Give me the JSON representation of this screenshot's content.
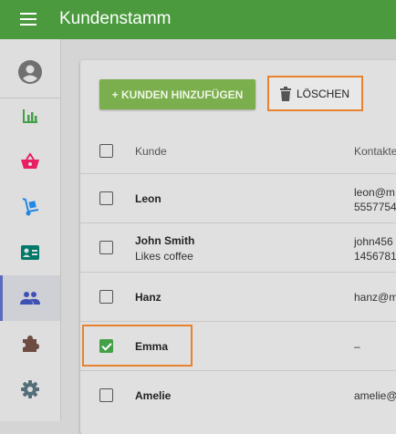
{
  "app": {
    "title": "Kundenstamm"
  },
  "icons": {
    "menu": "hamburger-menu-icon",
    "account": "account-circle-icon",
    "delete": "trash-icon"
  },
  "sidebar": {
    "items": [
      {
        "name": "sidebar-item-statistics",
        "icon": "bar-chart-icon",
        "color": "#43a047"
      },
      {
        "name": "sidebar-item-shop",
        "icon": "basket-icon",
        "color": "#e91e63"
      },
      {
        "name": "sidebar-item-delivery",
        "icon": "hand-truck-icon",
        "color": "#1e88e5"
      },
      {
        "name": "sidebar-item-contact-card",
        "icon": "contact-card-icon",
        "color": "#00796b"
      },
      {
        "name": "sidebar-item-customers",
        "icon": "people-icon",
        "color": "#3f51b5",
        "active": true
      },
      {
        "name": "sidebar-item-extensions",
        "icon": "puzzle-icon",
        "color": "#6d4c41"
      },
      {
        "name": "sidebar-item-settings",
        "icon": "gear-icon",
        "color": "#546e7a"
      }
    ]
  },
  "toolbar": {
    "add_label": "+ KUNDEN HINZUFÜGEN",
    "delete_label": "LÖSCHEN"
  },
  "table": {
    "columns": [
      "Kunde",
      "Kontakte"
    ],
    "rows": [
      {
        "name": "Leon",
        "note": "",
        "contact_line1": "leon@m",
        "contact_line2": "5557754",
        "checked": false
      },
      {
        "name": "John Smith",
        "note": "Likes coffee",
        "contact_line1": "john456",
        "contact_line2": "1456781",
        "checked": false
      },
      {
        "name": "Hanz",
        "note": "",
        "contact_line1": "hanz@m",
        "contact_line2": "",
        "checked": false
      },
      {
        "name": "Emma",
        "note": "",
        "contact_line1": "–",
        "contact_line2": "",
        "checked": true
      },
      {
        "name": "Amelie",
        "note": "",
        "contact_line1": "amelie@",
        "contact_line2": "",
        "checked": false
      }
    ]
  },
  "colors": {
    "appbar": "#4b9a3e",
    "add_button": "#7bae4c",
    "highlight": "#e8822e",
    "checkbox_checked": "#43a047"
  }
}
